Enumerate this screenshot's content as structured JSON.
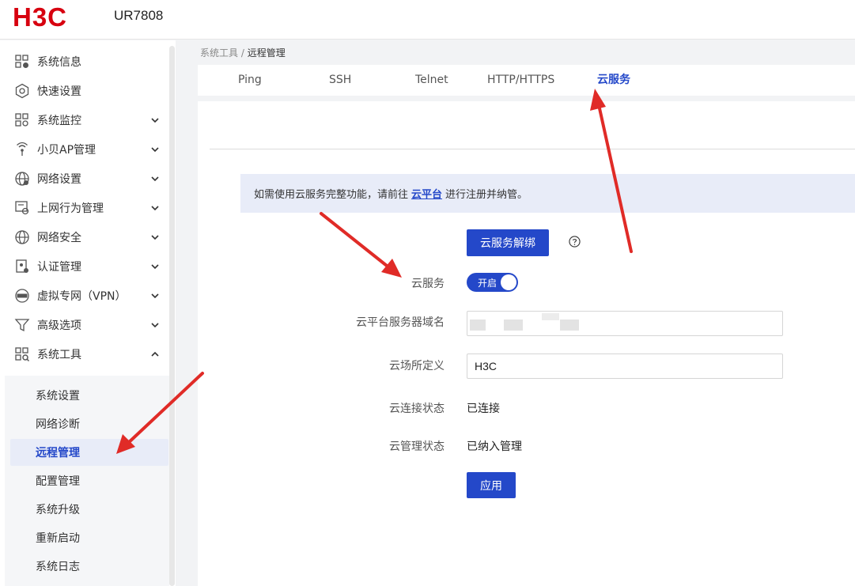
{
  "header": {
    "brand": "H3C",
    "model": "UR7808"
  },
  "sidebar": {
    "items": [
      {
        "label": "系统信息",
        "icon": "system-info-icon",
        "expandable": false
      },
      {
        "label": "快速设置",
        "icon": "quick-setup-icon",
        "expandable": false
      },
      {
        "label": "系统监控",
        "icon": "system-monitor-icon",
        "expandable": true
      },
      {
        "label": "小贝AP管理",
        "icon": "ap-management-icon",
        "expandable": true
      },
      {
        "label": "网络设置",
        "icon": "network-settings-icon",
        "expandable": true
      },
      {
        "label": "上网行为管理",
        "icon": "behavior-management-icon",
        "expandable": true
      },
      {
        "label": "网络安全",
        "icon": "network-security-icon",
        "expandable": true
      },
      {
        "label": "认证管理",
        "icon": "auth-management-icon",
        "expandable": true
      },
      {
        "label": "虚拟专网（VPN）",
        "icon": "vpn-icon",
        "expandable": true
      },
      {
        "label": "高级选项",
        "icon": "advanced-options-icon",
        "expandable": true
      },
      {
        "label": "系统工具",
        "icon": "system-tools-icon",
        "expandable": true,
        "expanded": true
      }
    ],
    "subitems": [
      {
        "label": "系统设置"
      },
      {
        "label": "网络诊断"
      },
      {
        "label": "远程管理",
        "active": true
      },
      {
        "label": "配置管理"
      },
      {
        "label": "系统升级"
      },
      {
        "label": "重新启动"
      },
      {
        "label": "系统日志"
      }
    ]
  },
  "breadcrumb": {
    "parent": "系统工具",
    "separator": " / ",
    "current": "远程管理"
  },
  "tabs": [
    {
      "label": "Ping"
    },
    {
      "label": "SSH"
    },
    {
      "label": "Telnet"
    },
    {
      "label": "HTTP/HTTPS"
    },
    {
      "label": "云服务",
      "active": true
    }
  ],
  "notice": {
    "before": "如需使用云服务完整功能，请前往",
    "link": "云平台",
    "after": "进行注册并纳管。"
  },
  "unbind_button": "云服务解绑",
  "form": {
    "cloud_service": {
      "label": "云服务",
      "toggle_text": "开启",
      "on": true
    },
    "server_domain": {
      "label": "云平台服务器域名",
      "value": ""
    },
    "site_name": {
      "label": "云场所定义",
      "value": "H3C"
    },
    "connect_status": {
      "label": "云连接状态",
      "value": "已连接"
    },
    "manage_status": {
      "label": "云管理状态",
      "value": "已纳入管理"
    }
  },
  "apply_button": "应用",
  "colors": {
    "accent": "#2448c9",
    "annotation_arrow": "#e02b27",
    "brand_red": "#d7000f"
  }
}
